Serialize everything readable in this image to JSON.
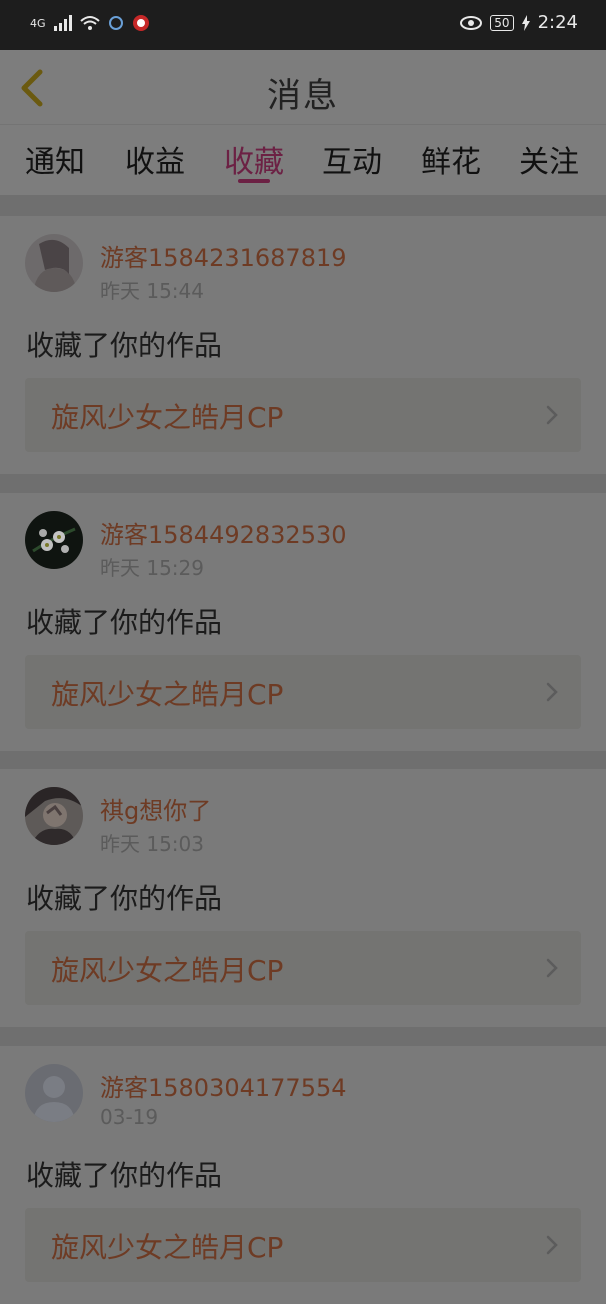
{
  "status_bar": {
    "network": "4G",
    "battery": "50",
    "time": "2:24"
  },
  "header": {
    "title": "消息"
  },
  "tabs": [
    {
      "label": "通知"
    },
    {
      "label": "收益"
    },
    {
      "label": "收藏",
      "active": true
    },
    {
      "label": "互动"
    },
    {
      "label": "鲜花"
    },
    {
      "label": "关注"
    }
  ],
  "feed": [
    {
      "username": "游客1584231687819",
      "time": "昨天 15:44",
      "action": "收藏了你的作品",
      "work_title": "旋风少女之皓月CP"
    },
    {
      "username": "游客1584492832530",
      "time": "昨天 15:29",
      "action": "收藏了你的作品",
      "work_title": "旋风少女之皓月CP"
    },
    {
      "username": "祺g想你了",
      "time": "昨天 15:03",
      "action": "收藏了你的作品",
      "work_title": "旋风少女之皓月CP"
    },
    {
      "username": "游客1580304177554",
      "time": "03-19",
      "action": "收藏了你的作品",
      "work_title": "旋风少女之皓月CP"
    }
  ],
  "colors": {
    "accent": "#6c2144",
    "username": "#6e3b24",
    "overlay_bg": "#7a7a7a"
  }
}
